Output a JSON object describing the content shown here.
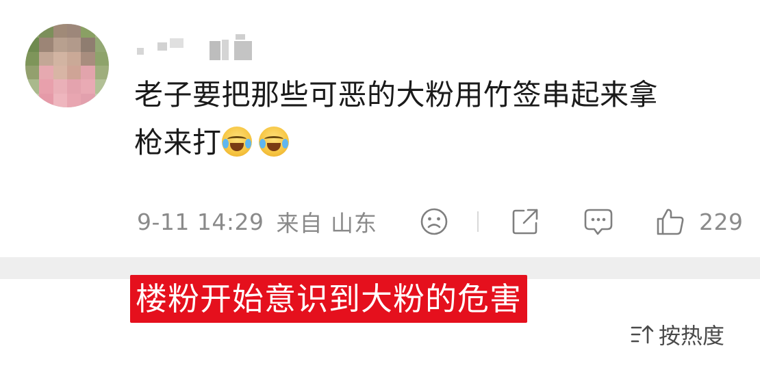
{
  "comment": {
    "avatar_icon": "pixelated-avatar",
    "username_icon": "pixelated-username",
    "text_line1": "老子要把那些可恶的大粉用竹签串起来拿",
    "text_line2": "枪来打",
    "emoji_icon": "laughing-crying-emoji",
    "time": "9-11 14:29",
    "location": "来自 山东",
    "likes": "229",
    "icons": {
      "dislike": "sad-face-icon",
      "share": "share-icon",
      "reply": "comment-bubble-icon",
      "like": "thumbs-up-icon"
    }
  },
  "caption": {
    "text": "楼粉开始意识到大粉的危害",
    "background": "#e5101d",
    "color": "#ffffff"
  },
  "sort": {
    "label": "按热度",
    "icon": "sort-icon"
  },
  "colors": {
    "text": "#1a1a1a",
    "meta": "#8a8a8a",
    "separator": "#eeeeee"
  }
}
